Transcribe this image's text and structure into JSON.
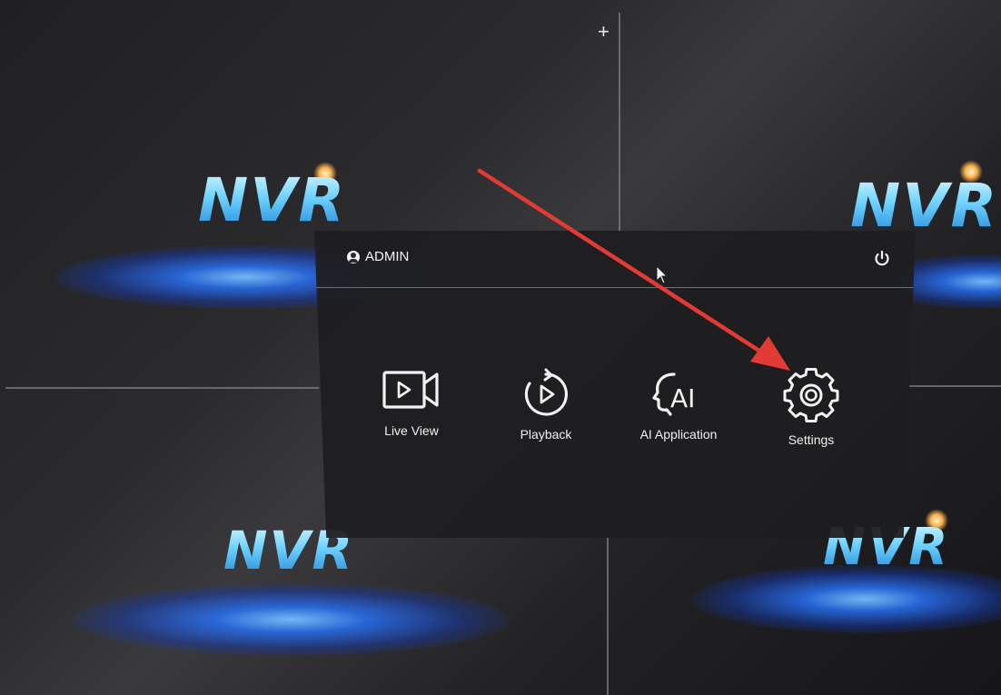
{
  "wallpaper": {
    "logo_text": "NVR",
    "tiles": [
      "NVR",
      "NVR",
      "NVR",
      "NVR"
    ]
  },
  "menu": {
    "user_label": "ADMIN",
    "items": [
      {
        "label": "Live View",
        "icon": "video-camera-icon"
      },
      {
        "label": "Playback",
        "icon": "playback-icon"
      },
      {
        "label": "AI Application",
        "icon": "ai-head-icon"
      },
      {
        "label": "Settings",
        "icon": "gear-icon"
      }
    ]
  },
  "icons": {
    "user": "user-circle-icon",
    "power": "power-icon",
    "split_add": "plus-icon",
    "cursor": "mouse-pointer-icon"
  },
  "annotation": {
    "arrow_color": "#e23a35",
    "points_to": "Settings"
  },
  "colors": {
    "accent_blue": "#2a7bff",
    "logo_cyan": "#6fd3ff",
    "menu_bg": "#1e1e20",
    "text": "#f0f0f0"
  }
}
